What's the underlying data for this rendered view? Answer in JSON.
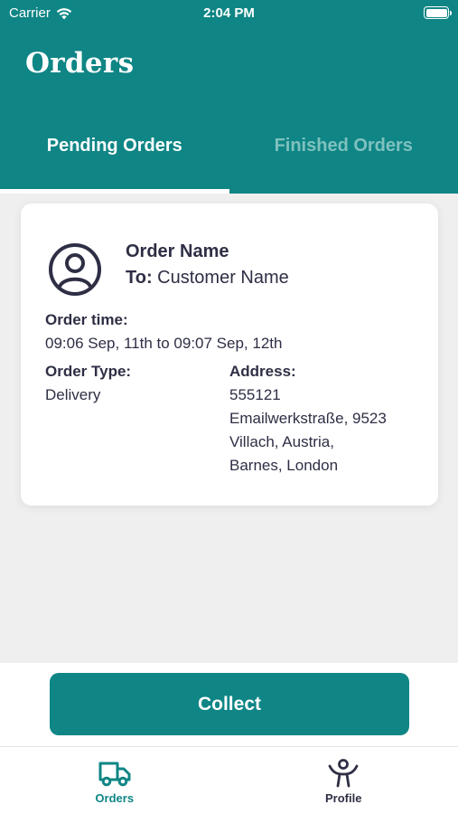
{
  "status_bar": {
    "carrier": "Carrier",
    "time": "2:04 PM"
  },
  "header": {
    "title": "Orders"
  },
  "tabs": [
    {
      "label": "Pending Orders",
      "active": true
    },
    {
      "label": "Finished Orders",
      "active": false
    }
  ],
  "order": {
    "name": "Order Name",
    "to_label": "To:",
    "customer": "Customer Name",
    "time_label": "Order time:",
    "time_value": "09:06 Sep, 11th to 09:07 Sep, 12th",
    "type_label": "Order Type:",
    "type_value": "Delivery",
    "address_label": "Address:",
    "address_lines": [
      "555121",
      "Emailwerkstraße, 9523",
      "Villach, Austria,",
      "Barnes, London"
    ]
  },
  "actions": {
    "collect_label": "Collect"
  },
  "tabbar": [
    {
      "label": "Orders",
      "icon": "truck-icon",
      "active": true
    },
    {
      "label": "Profile",
      "icon": "person-icon",
      "active": false
    }
  ],
  "colors": {
    "accent": "#0f8585",
    "text": "#2e2f45",
    "tab_inactive": "#7fc1bf",
    "background": "#efefef"
  }
}
